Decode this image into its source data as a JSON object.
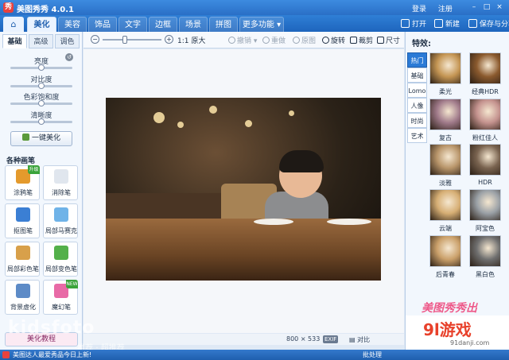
{
  "app": {
    "title": "美图秀秀 4.0.1",
    "icon": "app-logo-icon",
    "brand_color": "#2a6fc6"
  },
  "titlebar": {
    "login": "登录",
    "register": "注册"
  },
  "nav": {
    "tabs": [
      {
        "label": "美化",
        "active": true
      },
      {
        "label": "美容",
        "active": false
      },
      {
        "label": "饰品",
        "active": false
      },
      {
        "label": "文字",
        "active": false
      },
      {
        "label": "边框",
        "active": false
      },
      {
        "label": "场景",
        "active": false
      },
      {
        "label": "拼图",
        "active": false
      },
      {
        "label": "更多功能 ▾",
        "active": false
      }
    ],
    "open": "打开",
    "new": "新建",
    "save_share": "保存与分享"
  },
  "leftpanel": {
    "subtabs": [
      "基础",
      "高级",
      "调色"
    ],
    "sliders": [
      {
        "label": "亮度",
        "value": 0.5
      },
      {
        "label": "对比度",
        "value": 0.5
      },
      {
        "label": "色彩饱和度",
        "value": 0.5
      },
      {
        "label": "清晰度",
        "value": 0.5
      }
    ],
    "onekey": "一键美化",
    "section_title": "各种画笔",
    "brushes": [
      {
        "label": "涂鸦笔",
        "icon": "doodle-pen-icon",
        "badge": "升级",
        "color": "#e49a2c"
      },
      {
        "label": "消除笔",
        "icon": "eraser-icon",
        "badge": "",
        "color": "#e0e6ee"
      },
      {
        "label": "抠图笔",
        "icon": "cutout-pen-icon",
        "badge": "",
        "color": "#3b7fd4"
      },
      {
        "label": "局部马赛克",
        "icon": "mosaic-icon",
        "badge": "",
        "color": "#6fb3e8"
      },
      {
        "label": "局部彩色笔",
        "icon": "color-pen-icon",
        "badge": "",
        "color": "#d8a04a"
      },
      {
        "label": "局部变色笔",
        "icon": "recolor-pen-icon",
        "badge": "",
        "color": "#53b04a"
      },
      {
        "label": "背景虚化",
        "icon": "bokeh-icon",
        "badge": "",
        "color": "#5d8bc7"
      },
      {
        "label": "魔幻笔",
        "icon": "magic-pen-icon",
        "badge": "NEW",
        "color": "#e86aa6"
      }
    ],
    "tutorial": "美化教程"
  },
  "toolbar": {
    "zoom_minus": "−",
    "zoom_plus": "+",
    "zoom_level": 0.35,
    "original_size": "1:1 原大",
    "undo": "撤销 ▾",
    "redo": "重做",
    "original": "原图",
    "rotate": "旋转",
    "crop": "裁剪",
    "resize": "尺寸"
  },
  "canvas": {
    "dimensions": "800 × 533",
    "exif": "EXIF",
    "compare": "对比"
  },
  "rightpanel": {
    "title": "特效:",
    "categories": [
      "热门",
      "基础",
      "Lomo",
      "人像",
      "时尚",
      "艺术"
    ],
    "effects": [
      {
        "label": "柔光",
        "color": "#c49553"
      },
      {
        "label": "经典HDR",
        "color": "#8b5a2e"
      },
      {
        "label": "复古",
        "color": "#a07a8a"
      },
      {
        "label": "粉红佳人",
        "color": "#c4928e"
      },
      {
        "label": "淡雅",
        "color": "#b8956a"
      },
      {
        "label": "HDR",
        "color": "#7a6450"
      },
      {
        "label": "云端",
        "color": "#d6ae74"
      },
      {
        "label": "阿宝色",
        "color": "#9aa0a6"
      },
      {
        "label": "后青春",
        "color": "#caa06a"
      },
      {
        "label": "黑白色",
        "color": "#6f6f6f"
      }
    ],
    "logo": "美图秀秀出"
  },
  "watermark": {
    "main": "kidsfoto",
    "sub": "·推荐 · 超推荐"
  },
  "brand": {
    "big": "9l游戏",
    "small": "91danji.com"
  },
  "bottombar": {
    "text": "美图达人最爱秀品今日上新!",
    "batch": "批处理"
  }
}
